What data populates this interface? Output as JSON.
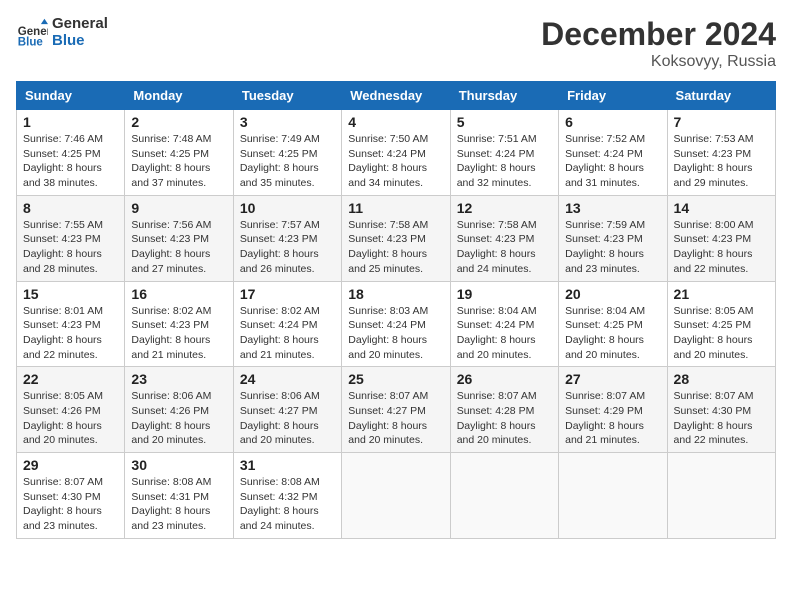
{
  "header": {
    "logo_line1": "General",
    "logo_line2": "Blue",
    "month": "December 2024",
    "location": "Koksovyy, Russia"
  },
  "days_of_week": [
    "Sunday",
    "Monday",
    "Tuesday",
    "Wednesday",
    "Thursday",
    "Friday",
    "Saturday"
  ],
  "weeks": [
    [
      {
        "day": "1",
        "sunrise": "7:46 AM",
        "sunset": "4:25 PM",
        "daylight": "8 hours and 38 minutes."
      },
      {
        "day": "2",
        "sunrise": "7:48 AM",
        "sunset": "4:25 PM",
        "daylight": "8 hours and 37 minutes."
      },
      {
        "day": "3",
        "sunrise": "7:49 AM",
        "sunset": "4:25 PM",
        "daylight": "8 hours and 35 minutes."
      },
      {
        "day": "4",
        "sunrise": "7:50 AM",
        "sunset": "4:24 PM",
        "daylight": "8 hours and 34 minutes."
      },
      {
        "day": "5",
        "sunrise": "7:51 AM",
        "sunset": "4:24 PM",
        "daylight": "8 hours and 32 minutes."
      },
      {
        "day": "6",
        "sunrise": "7:52 AM",
        "sunset": "4:24 PM",
        "daylight": "8 hours and 31 minutes."
      },
      {
        "day": "7",
        "sunrise": "7:53 AM",
        "sunset": "4:23 PM",
        "daylight": "8 hours and 29 minutes."
      }
    ],
    [
      {
        "day": "8",
        "sunrise": "7:55 AM",
        "sunset": "4:23 PM",
        "daylight": "8 hours and 28 minutes."
      },
      {
        "day": "9",
        "sunrise": "7:56 AM",
        "sunset": "4:23 PM",
        "daylight": "8 hours and 27 minutes."
      },
      {
        "day": "10",
        "sunrise": "7:57 AM",
        "sunset": "4:23 PM",
        "daylight": "8 hours and 26 minutes."
      },
      {
        "day": "11",
        "sunrise": "7:58 AM",
        "sunset": "4:23 PM",
        "daylight": "8 hours and 25 minutes."
      },
      {
        "day": "12",
        "sunrise": "7:58 AM",
        "sunset": "4:23 PM",
        "daylight": "8 hours and 24 minutes."
      },
      {
        "day": "13",
        "sunrise": "7:59 AM",
        "sunset": "4:23 PM",
        "daylight": "8 hours and 23 minutes."
      },
      {
        "day": "14",
        "sunrise": "8:00 AM",
        "sunset": "4:23 PM",
        "daylight": "8 hours and 22 minutes."
      }
    ],
    [
      {
        "day": "15",
        "sunrise": "8:01 AM",
        "sunset": "4:23 PM",
        "daylight": "8 hours and 22 minutes."
      },
      {
        "day": "16",
        "sunrise": "8:02 AM",
        "sunset": "4:23 PM",
        "daylight": "8 hours and 21 minutes."
      },
      {
        "day": "17",
        "sunrise": "8:02 AM",
        "sunset": "4:24 PM",
        "daylight": "8 hours and 21 minutes."
      },
      {
        "day": "18",
        "sunrise": "8:03 AM",
        "sunset": "4:24 PM",
        "daylight": "8 hours and 20 minutes."
      },
      {
        "day": "19",
        "sunrise": "8:04 AM",
        "sunset": "4:24 PM",
        "daylight": "8 hours and 20 minutes."
      },
      {
        "day": "20",
        "sunrise": "8:04 AM",
        "sunset": "4:25 PM",
        "daylight": "8 hours and 20 minutes."
      },
      {
        "day": "21",
        "sunrise": "8:05 AM",
        "sunset": "4:25 PM",
        "daylight": "8 hours and 20 minutes."
      }
    ],
    [
      {
        "day": "22",
        "sunrise": "8:05 AM",
        "sunset": "4:26 PM",
        "daylight": "8 hours and 20 minutes."
      },
      {
        "day": "23",
        "sunrise": "8:06 AM",
        "sunset": "4:26 PM",
        "daylight": "8 hours and 20 minutes."
      },
      {
        "day": "24",
        "sunrise": "8:06 AM",
        "sunset": "4:27 PM",
        "daylight": "8 hours and 20 minutes."
      },
      {
        "day": "25",
        "sunrise": "8:07 AM",
        "sunset": "4:27 PM",
        "daylight": "8 hours and 20 minutes."
      },
      {
        "day": "26",
        "sunrise": "8:07 AM",
        "sunset": "4:28 PM",
        "daylight": "8 hours and 20 minutes."
      },
      {
        "day": "27",
        "sunrise": "8:07 AM",
        "sunset": "4:29 PM",
        "daylight": "8 hours and 21 minutes."
      },
      {
        "day": "28",
        "sunrise": "8:07 AM",
        "sunset": "4:30 PM",
        "daylight": "8 hours and 22 minutes."
      }
    ],
    [
      {
        "day": "29",
        "sunrise": "8:07 AM",
        "sunset": "4:30 PM",
        "daylight": "8 hours and 23 minutes."
      },
      {
        "day": "30",
        "sunrise": "8:08 AM",
        "sunset": "4:31 PM",
        "daylight": "8 hours and 23 minutes."
      },
      {
        "day": "31",
        "sunrise": "8:08 AM",
        "sunset": "4:32 PM",
        "daylight": "8 hours and 24 minutes."
      },
      null,
      null,
      null,
      null
    ]
  ],
  "labels": {
    "sunrise": "Sunrise:",
    "sunset": "Sunset:",
    "daylight": "Daylight:"
  }
}
